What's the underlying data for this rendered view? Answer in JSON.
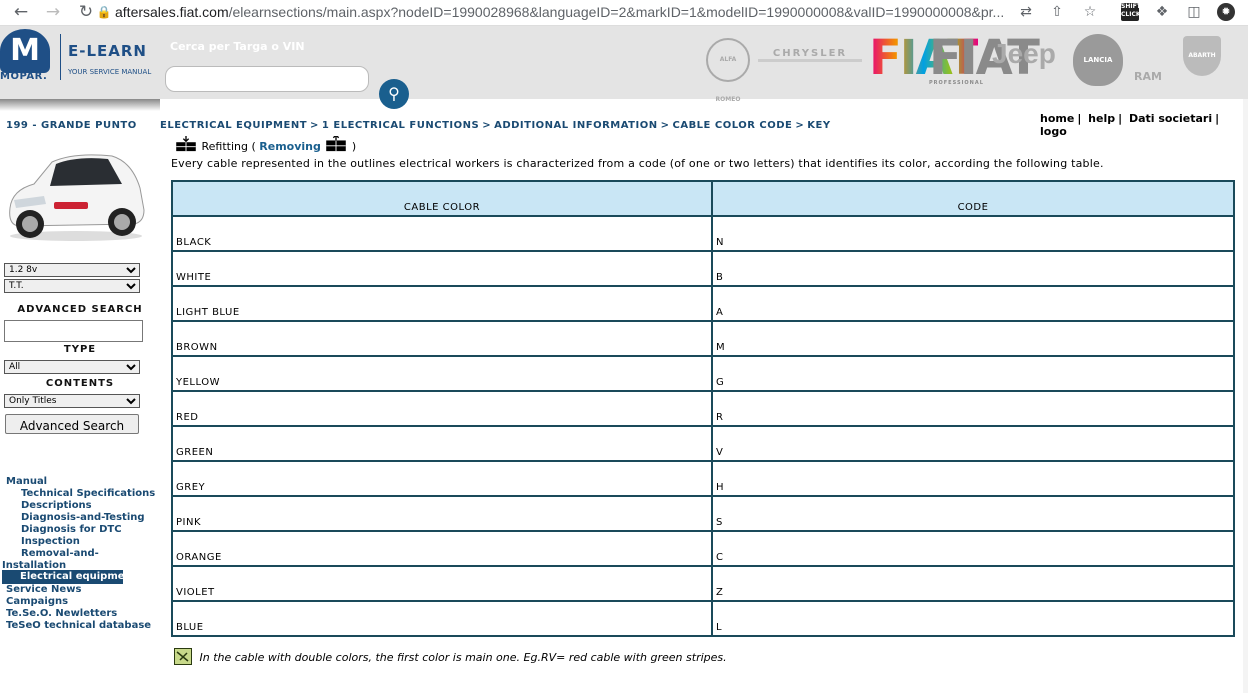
{
  "browser": {
    "url_host": "aftersales.fiat.com",
    "url_path": "/elearnsections/main.aspx?nodeID=1990028968&languageID=2&markID=1&modelID=1990000008&valID=1990000008&pr..."
  },
  "header": {
    "mopar_text": "MOPAR.",
    "elearn_title": "E-LEARN",
    "elearn_subtitle": "YOUR SERVICE MANUAL",
    "search_label": "Cerca per Targa o VIN",
    "search_value": "",
    "brands": [
      "ALFA ROMEO",
      "CHRYSLER",
      "FIAT",
      "FIAT",
      "Jeep",
      "LANCIA",
      "RAM",
      "ABARTH"
    ],
    "brand_professional": "PROFESSIONAL",
    "links": [
      "home",
      "help",
      "Dati societari",
      "logo"
    ]
  },
  "sidebar": {
    "model_title": "199 - GRANDE PUNTO",
    "engine_select": "1.2 8v",
    "version_select": "T.T.",
    "advanced_search_label": "ADVANCED SEARCH",
    "advanced_search_value": "",
    "type_label": "TYPE",
    "type_select": "All",
    "contents_label": "CONTENTS",
    "contents_select": "Only Titles",
    "advanced_search_button": "Advanced Search",
    "menu": {
      "manual": "Manual",
      "items": [
        "Technical Specifications",
        "Descriptions",
        "Diagnosis-and-Testing",
        "Diagnosis for DTC",
        "Inspection"
      ],
      "removal_1": "Removal-and-",
      "removal_2": "Installation",
      "active": "Electrical equipment",
      "others": [
        "Service News",
        "Campaigns",
        "Te.Se.O. Newletters",
        "TeSeO technical database"
      ]
    }
  },
  "main": {
    "breadcrumb": [
      "ELECTRICAL EQUIPMENT",
      "1 ELECTRICAL FUNCTIONS",
      "ADDITIONAL INFORMATION",
      "CABLE COLOR CODE",
      "KEY"
    ],
    "breadcrumb_sep": ">",
    "refitting": "Refitting (",
    "removing": "Removing",
    "close_paren": ")",
    "intro": "Every cable represented in the outlines electrical workers is characterized from a code (of one or two letters) that identifies its color, according the following table.",
    "table": {
      "headers": [
        "CABLE COLOR",
        "CODE"
      ],
      "rows": [
        [
          "BLACK",
          "N"
        ],
        [
          "WHITE",
          "B"
        ],
        [
          "LIGHT BLUE",
          "A"
        ],
        [
          "BROWN",
          "M"
        ],
        [
          "YELLOW",
          "G"
        ],
        [
          "RED",
          "R"
        ],
        [
          "GREEN",
          "V"
        ],
        [
          "GREY",
          "H"
        ],
        [
          "PINK",
          "S"
        ],
        [
          "ORANGE",
          "C"
        ],
        [
          "VIOLET",
          "Z"
        ],
        [
          "BLUE",
          "L"
        ]
      ]
    },
    "note": "In the cable with double colors, the first color is main one. Eg.RV= red cable with green stripes."
  }
}
